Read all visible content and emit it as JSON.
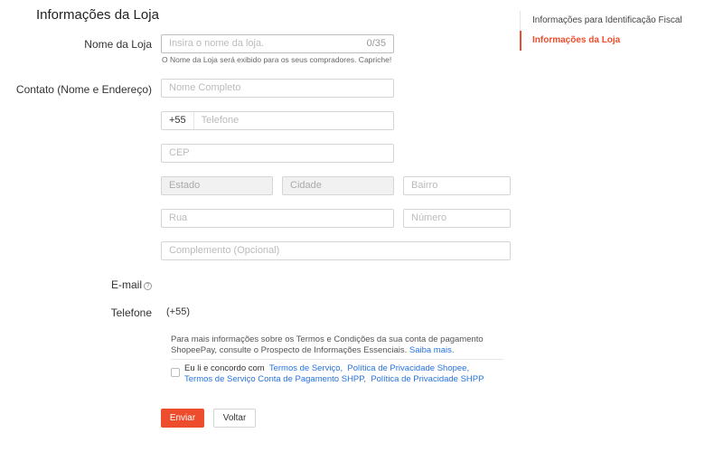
{
  "page": {
    "title": "Informações da Loja"
  },
  "form": {
    "store_name": {
      "label": "Nome da Loja",
      "placeholder": "Insira o nome da loja.",
      "counter": "0/35",
      "hint": "O Nome da Loja será exibido para os seus compradores. Capriche!"
    },
    "contact": {
      "label": "Contato (Nome e Endereço)",
      "full_name_placeholder": "Nome Completo",
      "phone_prefix": "+55",
      "phone_placeholder": "Telefone",
      "cep_placeholder": "CEP",
      "state_placeholder": "Estado",
      "city_placeholder": "Cidade",
      "district_placeholder": "Bairro",
      "street_placeholder": "Rua",
      "number_placeholder": "Número",
      "complement_placeholder": "Complemento (Opcional)"
    },
    "email": {
      "label": "E-mail",
      "help_icon": "?"
    },
    "phone": {
      "label": "Telefone",
      "value": "(+55)"
    },
    "info": {
      "text": "Para mais informações sobre os Termos e Condições da sua conta de pagamento ShopeePay, consulte o Prospecto de Informações Essenciais.",
      "link": "Saiba mais."
    },
    "terms": {
      "intro": "Eu li e concordo com",
      "link1": "Termos de Serviço,",
      "link2": "Política de Privacidade Shopee,",
      "link3": "Termos de Serviço Conta de Pagamento SHPP,",
      "link4": "Política de Privacidade SHPP"
    },
    "buttons": {
      "submit": "Enviar",
      "back": "Voltar"
    }
  },
  "side_nav": {
    "items": [
      {
        "label": "Informações para Identificação Fiscal",
        "active": false
      },
      {
        "label": "Informações da Loja",
        "active": true
      }
    ]
  },
  "colors": {
    "accent": "#ee4d2d",
    "link": "#2673dd"
  }
}
